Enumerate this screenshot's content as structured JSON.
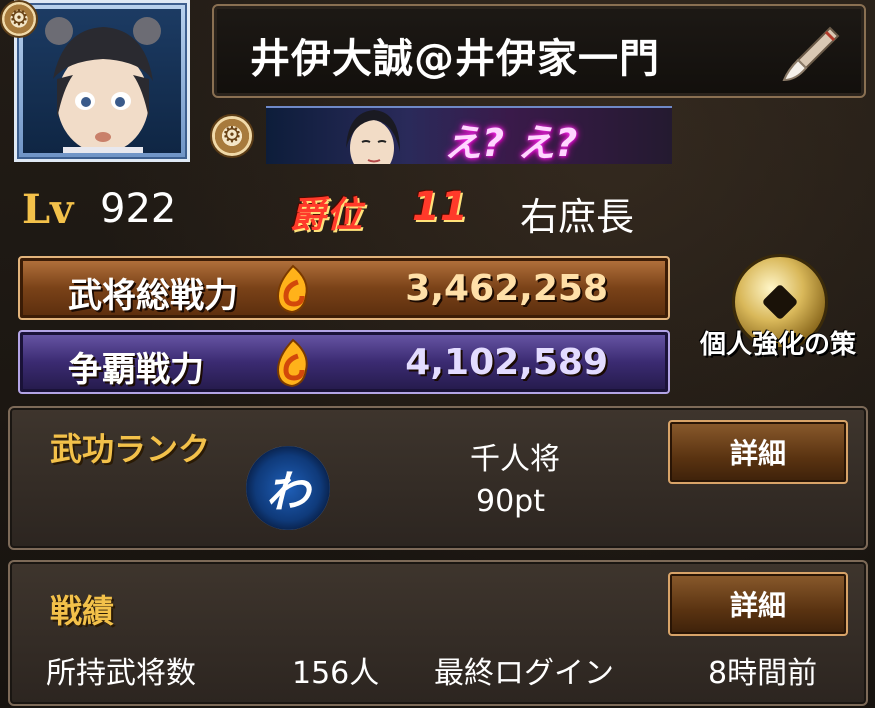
{
  "profile": {
    "player_name": "井伊大誠@井伊家一門",
    "level_label": "Lv",
    "level": "922",
    "rank_label": "爵位",
    "rank_value": "11",
    "title": "右庶長",
    "banner_text": "え? え?"
  },
  "power": {
    "general_label": "武将総戦力",
    "general_value": "3,462,258",
    "hegemony_label": "争覇戦力",
    "hegemony_value": "4,102,589"
  },
  "strengthen": {
    "label": "個人強化の策"
  },
  "merit": {
    "title": "武功ランク",
    "rank_name": "千人将",
    "points": "90pt",
    "detail_label": "詳細"
  },
  "record": {
    "title": "戦績",
    "detail_label": "詳細",
    "generals_label": "所持武将数",
    "generals_value": "156人",
    "last_login_label": "最終ログイン",
    "last_login_value": "8時間前"
  },
  "colors": {
    "gold": "#f3c14a",
    "rank_red": "#ff3a2a",
    "bronze_bar": "#7a4218",
    "purple_bar": "#3b2b72"
  }
}
